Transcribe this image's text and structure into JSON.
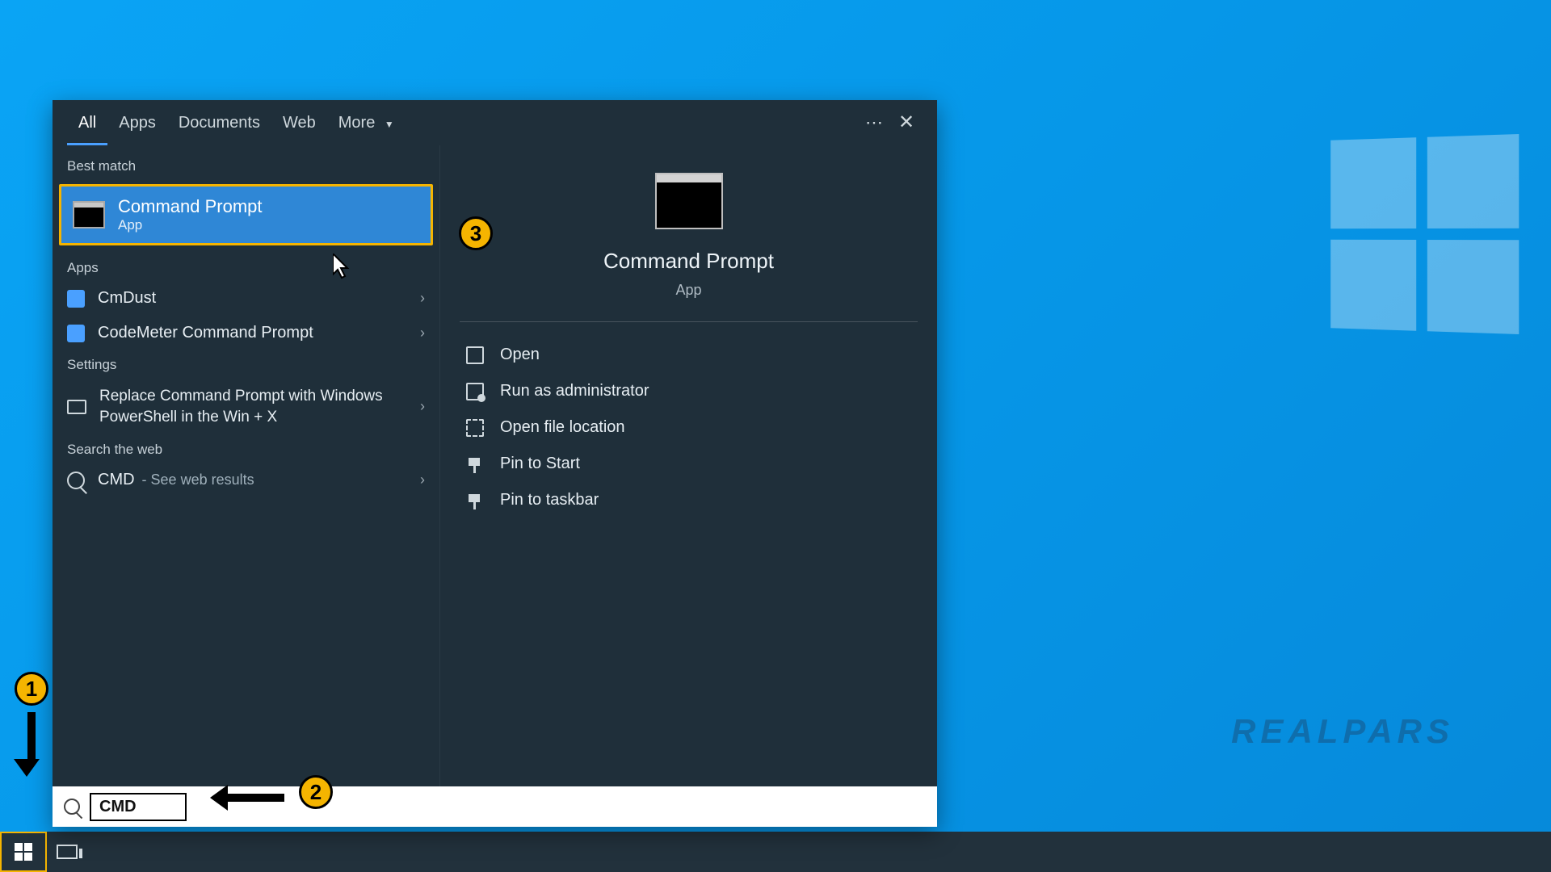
{
  "desktop": {
    "watermark": "REALPARS"
  },
  "tabs": {
    "all": "All",
    "apps": "Apps",
    "documents": "Documents",
    "web": "Web",
    "more": "More"
  },
  "sections": {
    "best_match": "Best match",
    "apps": "Apps",
    "settings": "Settings",
    "search_web": "Search the web"
  },
  "best_match": {
    "title": "Command Prompt",
    "subtitle": "App"
  },
  "apps_list": [
    {
      "label": "CmDust"
    },
    {
      "label": "CodeMeter Command Prompt"
    }
  ],
  "settings_list": [
    {
      "label": "Replace Command Prompt with Windows PowerShell in the Win + X"
    }
  ],
  "web_result": {
    "term": "CMD",
    "suffix": " - See web results"
  },
  "preview": {
    "title": "Command Prompt",
    "subtitle": "App",
    "actions": {
      "open": "Open",
      "admin": "Run as administrator",
      "location": "Open file location",
      "pin_start": "Pin to Start",
      "pin_taskbar": "Pin to taskbar"
    }
  },
  "search": {
    "query": "CMD"
  },
  "annotations": {
    "one": "1",
    "two": "2",
    "three": "3"
  }
}
